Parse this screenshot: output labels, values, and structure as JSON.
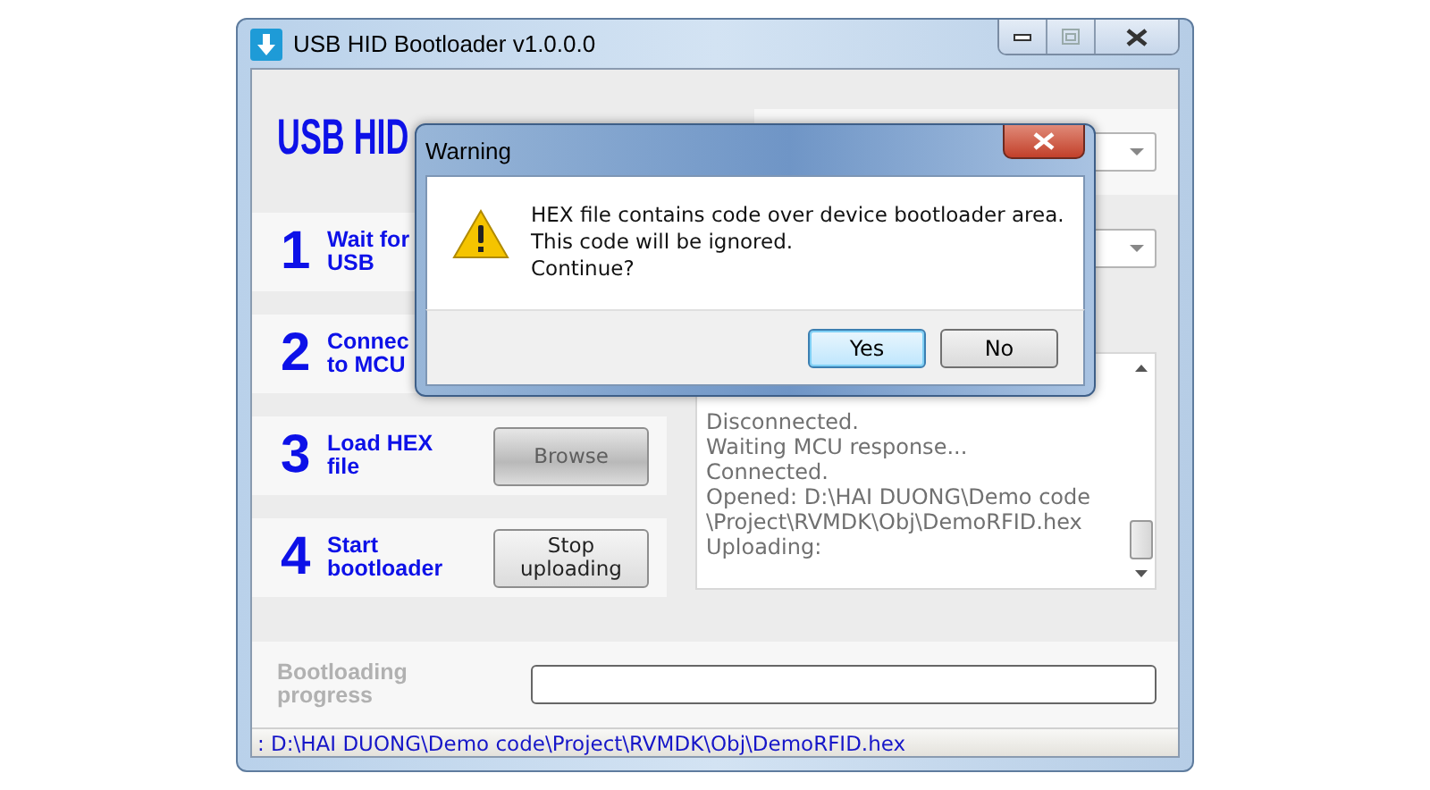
{
  "window": {
    "title": "USB HID Bootloader v1.0.0.0"
  },
  "logo": "USB HID",
  "steps": [
    {
      "number": "1",
      "label": [
        "Wait for",
        "USB"
      ]
    },
    {
      "number": "2",
      "label": [
        "Connec",
        "to MCU"
      ]
    },
    {
      "number": "3",
      "label": [
        "Load HEX",
        "file"
      ],
      "button": {
        "label": "Browse",
        "disabled": true
      }
    },
    {
      "number": "4",
      "label": [
        "Start",
        "bootloader"
      ],
      "button": {
        "label": "Stop uploading",
        "disabled": false
      }
    }
  ],
  "log": {
    "lines": [
      "Disconnected.",
      "Waiting MCU response...",
      "Connected.",
      "Opened: D:\\HAI DUONG\\Demo code",
      "\\Project\\RVMDK\\Obj\\DemoRFID.hex",
      "Uploading:"
    ]
  },
  "progress": {
    "label": "Bootloading progress",
    "disabled": true,
    "level": 0
  },
  "status_bar": ": D:\\HAI DUONG\\Demo code\\Project\\RVMDK\\Obj\\DemoRFID.hex",
  "dialog": {
    "title": "Warning",
    "message": [
      "HEX file contains code over device bootloader area.",
      "This code will be ignored.",
      "Continue?"
    ],
    "buttons": [
      {
        "label": "Yes",
        "selected": true
      },
      {
        "label": "No",
        "selected": false
      }
    ]
  }
}
